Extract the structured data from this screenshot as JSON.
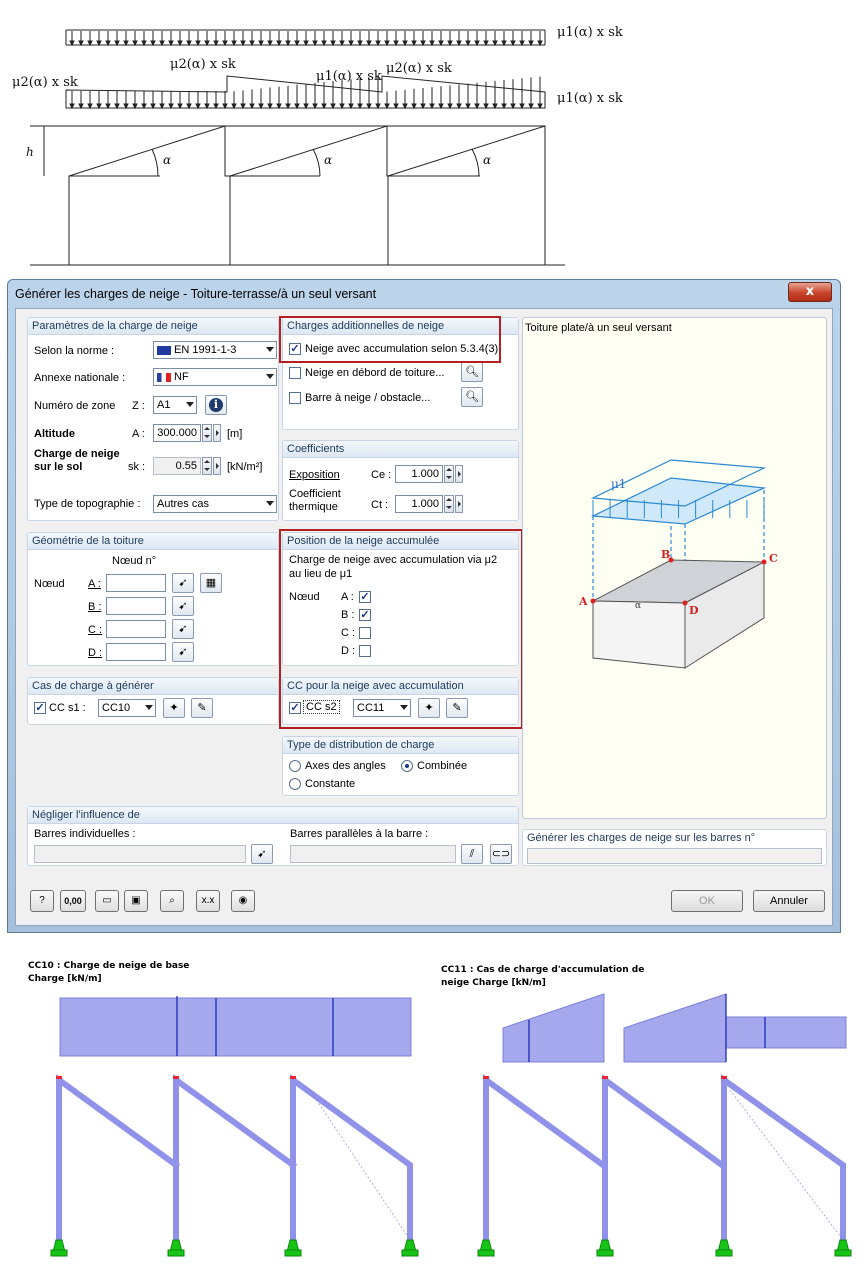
{
  "diagram": {
    "top_label": "μ1(α) x sk",
    "label_left": "μ2(α) x sk",
    "label_mid1": "μ2(α) x sk",
    "label_mid2": "μ1(α) x sk",
    "label_mid3": "μ2(α) x sk",
    "label_right": "μ1(α) x sk",
    "h_label": "h",
    "alpha_label": "α"
  },
  "dialog": {
    "title": "Générer les charges de neige - Toiture-terrasse/à un seul versant",
    "close_label": "x",
    "params": {
      "header": "Paramètres de la charge de neige",
      "norme_label": "Selon la norme :",
      "norme_value": "EN 1991-1-3",
      "annexe_label": "Annexe nationale :",
      "annexe_value": "NF",
      "zone_label": "Numéro de zone",
      "zone_symbol": "Z :",
      "zone_value": "A1",
      "altitude_label": "Altitude",
      "altitude_symbol": "A :",
      "altitude_value": "300.000",
      "altitude_unit": "[m]",
      "charge_label1": "Charge de neige",
      "charge_label2": "sur le sol",
      "charge_symbol": "sk :",
      "charge_value": "0.55",
      "charge_unit": "[kN/m²]",
      "topo_label": "Type de topographie :",
      "topo_value": "Autres cas"
    },
    "geometrie": {
      "header": "Géométrie de la toiture",
      "col_header": "Nœud n°",
      "row_label": "Nœud",
      "rows": [
        "A :",
        "B :",
        "C :",
        "D :"
      ]
    },
    "cas": {
      "header": "Cas de charge à générer",
      "cc_label": "CC s1 :",
      "cc_value": "CC10"
    },
    "additional": {
      "header": "Charges additionnelles de neige",
      "opt1": "Neige avec accumulation selon 5.3.4(3)",
      "opt2": "Neige en débord de toiture...",
      "opt3": "Barre à neige / obstacle..."
    },
    "coeff": {
      "header": "Coefficients",
      "expo_label": "Exposition",
      "expo_symbol": "Ce :",
      "expo_value": "1.000",
      "therm_label1": "Coefficient",
      "therm_label2": "thermique",
      "therm_symbol": "Ct :",
      "therm_value": "1.000"
    },
    "position": {
      "header": "Position de la neige accumulée",
      "desc1": "Charge de neige avec accumulation via μ2",
      "desc2": "au lieu de μ1",
      "node_label": "Nœud",
      "nodes": [
        "A :",
        "B :",
        "C :",
        "D :"
      ],
      "checked": [
        true,
        true,
        false,
        false
      ]
    },
    "ccaccum": {
      "header": "CC pour la neige avec accumulation",
      "cc_label": "CC s2",
      "cc_value": "CC11"
    },
    "distrib": {
      "header": "Type de distribution de charge",
      "opt1": "Axes des angles",
      "opt2": "Combinée",
      "opt3": "Constante"
    },
    "neglect": {
      "header": "Négliger l'influence de",
      "barres_ind": "Barres individuelles :",
      "barres_par": "Barres parallèles à la barre :"
    },
    "preview": {
      "title": "Toiture plate/à un seul versant",
      "mu": "μ1",
      "A": "A",
      "B": "B",
      "C": "C",
      "D": "D",
      "alpha": "α"
    },
    "generate": {
      "header": "Générer les charges de neige sur les barres n°"
    },
    "footer": {
      "ok": "OK",
      "cancel": "Annuler",
      "zero": "0,00"
    }
  },
  "results": {
    "left_caption1": "CC10 : Charge de neige de base",
    "left_caption2": "Charge [kN/m]",
    "right_caption1": "CC11 : Cas de charge d'accumulation de",
    "right_caption2": "neige Charge [kN/m]"
  },
  "colors": {
    "load_fill": "#a6a8ee",
    "accent_red": "#b21f24",
    "support_green": "#19c419"
  }
}
